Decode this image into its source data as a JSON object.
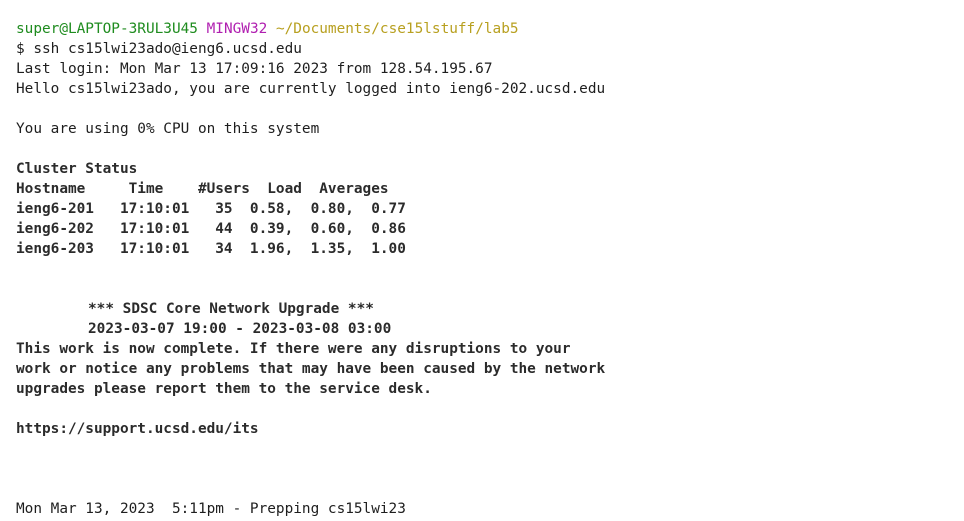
{
  "prompt": {
    "user_host": "super@LAPTOP-3RUL3U45",
    "msys": "MINGW32",
    "cwd": "~/Documents/cse15lstuff/lab5"
  },
  "command": "$ ssh cs15lwi23ado@ieng6.ucsd.edu",
  "last_login": "Last login: Mon Mar 13 17:09:16 2023 from 128.54.195.67",
  "hello": "Hello cs15lwi23ado, you are currently logged into ieng6-202.ucsd.edu",
  "cpu": "You are using 0% CPU on this system",
  "cluster": {
    "title": "Cluster Status",
    "header": "Hostname     Time    #Users  Load  Averages",
    "rows": [
      "ieng6-201   17:10:01   35  0.58,  0.80,  0.77",
      "ieng6-202   17:10:01   44  0.39,  0.60,  0.86",
      "ieng6-203   17:10:01   34  1.96,  1.35,  1.00"
    ]
  },
  "notice": {
    "title": "*** SDSC Core Network Upgrade ***",
    "dates": "2023-03-07 19:00 - 2023-03-08 03:00",
    "body": [
      "This work is now complete. If there were any disruptions to your",
      "work or notice any problems that may have been caused by the network",
      "upgrades please report them to the service desk."
    ],
    "link": "https://support.ucsd.edu/its"
  },
  "footer": "Mon Mar 13, 2023  5:11pm - Prepping cs15lwi23"
}
